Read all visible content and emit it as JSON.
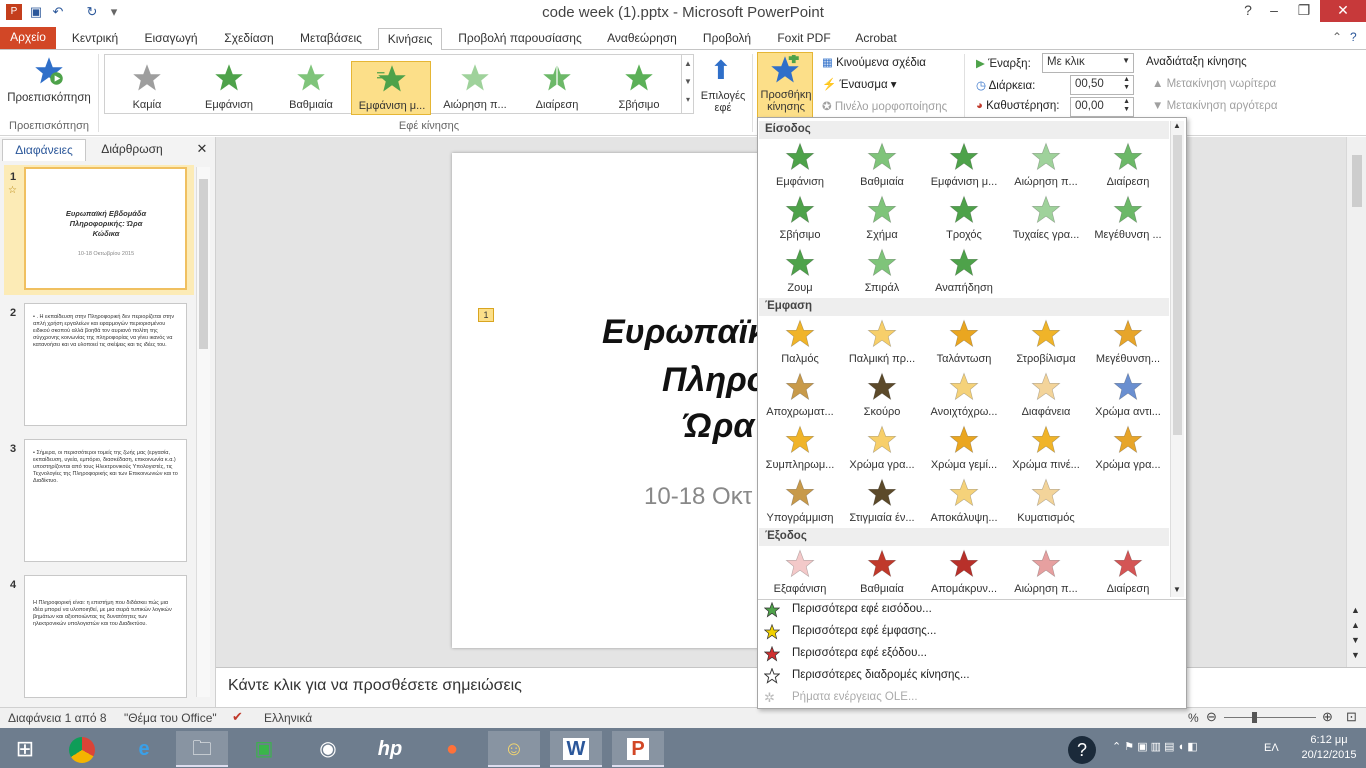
{
  "window": {
    "title": "code week (1).pptx - Microsoft PowerPoint"
  },
  "tabs": [
    "Αρχείο",
    "Κεντρική",
    "Εισαγωγή",
    "Σχεδίαση",
    "Μεταβάσεις",
    "Κινήσεις",
    "Προβολή παρουσίασης",
    "Αναθεώρηση",
    "Προβολή",
    "Foxit PDF",
    "Acrobat"
  ],
  "ribbon": {
    "preview_label": "Προεπισκόπηση",
    "preview_group": "Προεπισκόπηση",
    "gallery": [
      "Καμία",
      "Εμφάνιση",
      "Βαθμιαία",
      "Εμφάνιση μ...",
      "Αιώρηση π...",
      "Διαίρεση",
      "Σβήσιμο"
    ],
    "effect_options": "Επιλογές εφέ",
    "effects_group": "Εφέ κίνησης",
    "add_animation": "Προσθήκη κίνησης",
    "animation_pane": "Κινούμενα σχέδια",
    "trigger": "Έναυσμα",
    "painter": "Πινέλο μορφοποίησης",
    "start_label": "Έναρξη:",
    "start_value": "Με κλικ",
    "duration_label": "Διάρκεια:",
    "duration_value": "00,50",
    "delay_label": "Καθυστέρηση:",
    "delay_value": "00,00",
    "reorder": "Αναδιάταξη κίνησης",
    "move_earlier": "Μετακίνηση νωρίτερα",
    "move_later": "Μετακίνηση αργότερα"
  },
  "pane": {
    "tab_slides": "Διαφάνειες",
    "tab_outline": "Διάρθρωση"
  },
  "thumbs": [
    {
      "num": "1",
      "title": "Ευρωπαϊκή Εβδομάδα Πληροφορικής: Ώρα Κώδικα",
      "sub": "10-18 Οκτωβρίου 2015"
    },
    {
      "num": "2",
      "text": "• . Η εκπαίδευση στην Πληροφορική δεν περιορίζεται στην απλή χρήση εργαλείων και εφαρμογών περιορισμένου ειδικού σκοπού αλλά βοηθά τον αυριανό πολίτη της σύγχρονης κοινωνίας της πληροφορίας να γίνει ικανός να κατανοήσει και να υλοποιεί τις σκέψεις και τις ιδέες του."
    },
    {
      "num": "3",
      "text": "• Σήμερα, οι περισσότεροι τομείς της ζωής μας (εργασία, εκπαίδευση, υγεία, εμπόριο, διασκέδαση, επικοινωνία κ.α.) υποστηρίζονται από τους Ηλεκτρονικούς Υπολογιστές, τις Τεχνολογίες της Πληροφορικής και των Επικοινωνιών και το Διαδίκτυο."
    },
    {
      "num": "4",
      "text": "Η Πληροφορική είναι: η επιστήμη που διδάσκει πώς μια ιδέα μπορεί να υλοποιηθεί, με μια σειρά τυπικών λογικών βημάτων και αξιοποιώντας τις δυνατότητες των ηλεκτρονικών υπολογιστών και του Διαδικτύου."
    }
  ],
  "slide": {
    "marker": "1",
    "line1": "Ευρωπαϊκ",
    "line2": "Πληρο",
    "line3": "Ώρα",
    "date": "10-18 Οκτ"
  },
  "notes": "Κάντε κλικ για να προσθέσετε σημειώσεις",
  "status": {
    "slide": "Διαφάνεια 1 από 8",
    "theme": "\"Θέμα του Office\"",
    "lang": "Ελληνικά",
    "zoom_pct": "%"
  },
  "dropdown": {
    "entrance_head": "Είσοδος",
    "entrance": [
      "Εμφάνιση",
      "Βαθμιαία",
      "Εμφάνιση μ...",
      "Αιώρηση π...",
      "Διαίρεση",
      "Σβήσιμο",
      "Σχήμα",
      "Τροχός",
      "Τυχαίες γρα...",
      "Μεγέθυνση ...",
      "Ζουμ",
      "Σπιράλ",
      "Αναπήδηση"
    ],
    "emphasis_head": "Έμφαση",
    "emphasis": [
      "Παλμός",
      "Παλμική πρ...",
      "Ταλάντωση",
      "Στροβίλισμα",
      "Μεγέθυνση...",
      "Αποχρωματ...",
      "Σκούρο",
      "Ανοιχτόχρω...",
      "Διαφάνεια",
      "Χρώμα αντι...",
      "Συμπληρωμ...",
      "Χρώμα γρα...",
      "Χρώμα γεμί...",
      "Χρώμα πινέ...",
      "Χρώμα γρα...",
      "Υπογράμμιση",
      "Στιγμιαία έν...",
      "Αποκάλυψη...",
      "Κυματισμός"
    ],
    "exit_head": "Έξοδος",
    "exit": [
      "Εξαφάνιση",
      "Βαθμιαία",
      "Απομάκρυν...",
      "Αιώρηση π...",
      "Διαίρεση"
    ],
    "more": [
      "Περισσότερα εφέ εισόδου...",
      "Περισσότερα εφέ έμφασης...",
      "Περισσότερα εφέ εξόδου...",
      "Περισσότερες διαδρομές κίνησης...",
      "Ρήματα ενέργειας OLE..."
    ]
  },
  "clock": {
    "time": "6:12 μμ",
    "date": "20/12/2015",
    "lang": "ΕΛ"
  },
  "colors": {
    "green": "#4ea24a",
    "gold": "#f0b429",
    "red": "#c0392b",
    "file_tab": "#d24726",
    "accent": "#fcdf89"
  }
}
